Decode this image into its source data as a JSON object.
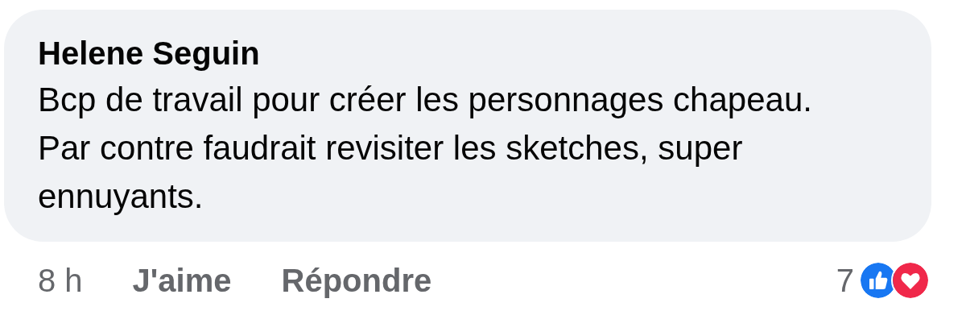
{
  "comment": {
    "author": "Helene Seguin",
    "text": "Bcp de travail pour créer les personnages chapeau. Par contre faudrait revisiter les sketches, super ennuyants."
  },
  "footer": {
    "time": "8 h",
    "actions": [
      "J'aime",
      "Répondre"
    ],
    "reaction_count": "7",
    "reactions": [
      {
        "kind": "like"
      },
      {
        "kind": "love"
      }
    ]
  }
}
